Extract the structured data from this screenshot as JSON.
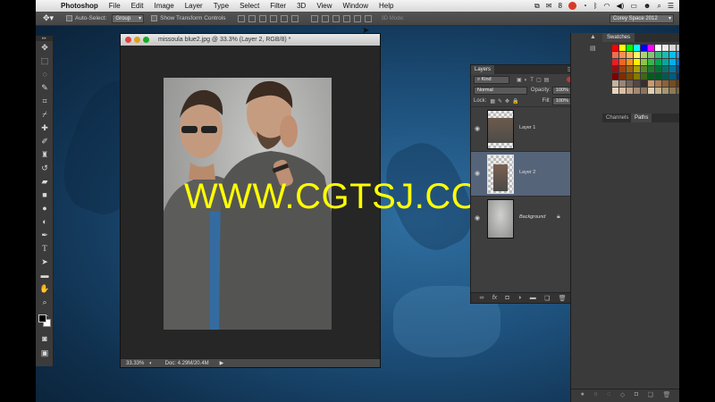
{
  "menubar": {
    "app_name": "Photoshop",
    "items": [
      "File",
      "Edit",
      "Image",
      "Layer",
      "Type",
      "Select",
      "Filter",
      "3D",
      "View",
      "Window",
      "Help"
    ],
    "battery_number": "8"
  },
  "options": {
    "auto_select_label": "Auto-Select:",
    "auto_select_value": "Group",
    "transform_label": "Show Transform Controls",
    "mode_3d_label": "3D Mode:",
    "workspace": "Corey Space 2012"
  },
  "document": {
    "title": "missoula blue2.jpg @ 33.3% (Layer 2, RGB/8) *",
    "zoom": "33.33%",
    "doc_size": "Doc: 4.29M/20.4M"
  },
  "watermark": "WWW.CGTSJ.COM",
  "layers_panel": {
    "tab": "Layers",
    "kind_label": "Kind",
    "blend_mode": "Normal",
    "opacity_label": "Opacity:",
    "opacity_value": "100%",
    "lock_label": "Lock:",
    "fill_label": "Fill:",
    "fill_value": "100%",
    "layers": [
      {
        "name": "Layer 1",
        "selected": false
      },
      {
        "name": "Layer 2",
        "selected": true
      },
      {
        "name": "Background",
        "selected": false
      }
    ]
  },
  "dock": {
    "swatches_tab": "Swatches",
    "channels_tab": "Channels",
    "paths_tab": "Paths"
  },
  "colors": {
    "watermark": "#ffff00",
    "selected_layer": "#56647a",
    "panel_bg": "#3e3e3e"
  }
}
